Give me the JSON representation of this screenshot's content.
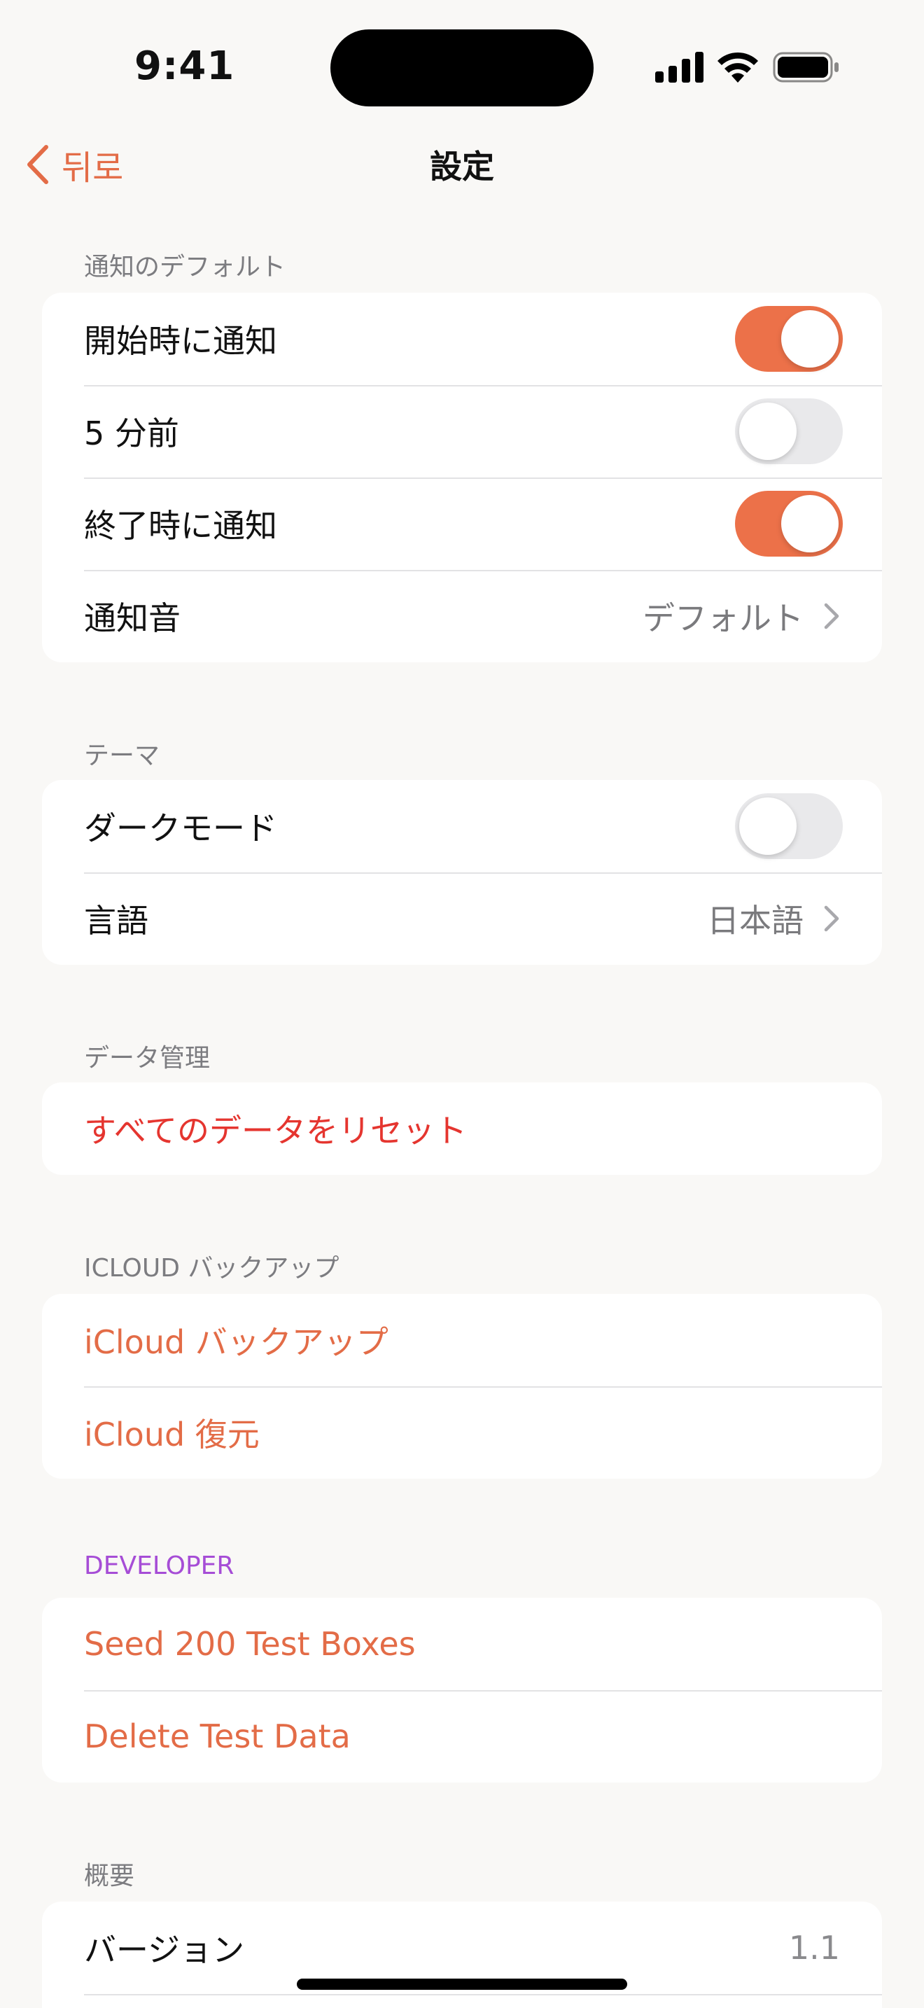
{
  "status": {
    "time": "9:41"
  },
  "nav": {
    "back_label": "뒤로",
    "title": "設定"
  },
  "notifications": {
    "header": "通知のデフォルト",
    "start_label": "開始時に通知",
    "start_on": true,
    "five_min_label": "5 分前",
    "five_min_on": false,
    "end_label": "終了時に通知",
    "end_on": true,
    "sound_label": "通知音",
    "sound_value": "デフォルト"
  },
  "theme": {
    "header": "テーマ",
    "dark_label": "ダークモード",
    "dark_on": false,
    "lang_label": "言語",
    "lang_value": "日本語"
  },
  "data": {
    "header": "データ管理",
    "reset_label": "すべてのデータをリセット"
  },
  "icloud": {
    "header": "ICLOUD バックアップ",
    "backup_label": "iCloud バックアップ",
    "restore_label": "iCloud 復元"
  },
  "developer": {
    "header": "DEVELOPER",
    "seed_label": "Seed 200 Test Boxes",
    "delete_label": "Delete Test Data"
  },
  "about": {
    "header": "概要",
    "version_label": "バージョン",
    "version_value": "1.1"
  },
  "colors": {
    "accent": "#e36c47",
    "destructive": "#e5352f",
    "developer": "#a64dd6"
  },
  "icons": [
    "cellular-signal-icon",
    "wifi-icon",
    "battery-icon",
    "chevron-left-icon",
    "chevron-right-icon"
  ]
}
